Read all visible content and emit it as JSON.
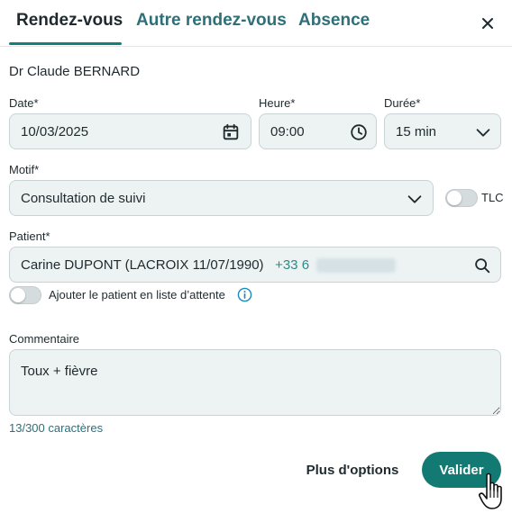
{
  "tabs": [
    {
      "label": "Rendez-vous",
      "active": true
    },
    {
      "label": "Autre rendez-vous",
      "active": false
    },
    {
      "label": "Absence",
      "active": false
    }
  ],
  "doctor_name": "Dr Claude BERNARD",
  "date": {
    "label": "Date*",
    "value": "10/03/2025",
    "icon": "calendar-icon"
  },
  "heure": {
    "label": "Heure*",
    "value": "09:00",
    "icon": "clock-icon"
  },
  "duree": {
    "label": "Durée*",
    "value": "15 min",
    "icon": "chevron-down-icon"
  },
  "motif": {
    "label": "Motif*",
    "value": "Consultation de suivi",
    "tlc_label": "TLC",
    "tlc_on": false
  },
  "patient": {
    "label": "Patient*",
    "name": "Carine DUPONT (LACROIX 11/07/1990)",
    "phone_prefix": "+33 6",
    "waitlist_label": "Ajouter le patient en liste d’attente",
    "waitlist_on": false
  },
  "commentaire": {
    "label": "Commentaire",
    "value": "Toux + fièvre",
    "counter": "13/300 caractères"
  },
  "actions": {
    "options_label": "Plus d'options",
    "submit_label": "Valider"
  },
  "colors": {
    "accent": "#137a73",
    "tab_inactive": "#2f6f78",
    "field_bg": "#edf2f3"
  }
}
